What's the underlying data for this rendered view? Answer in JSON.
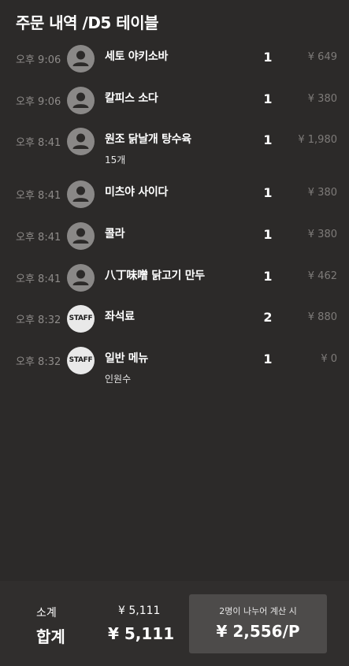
{
  "header": {
    "title": "주문 내역 /D5 테이블"
  },
  "orders": [
    {
      "time": "오후 9:06",
      "avatar": "person-icon",
      "name": "세토 야키소바",
      "note": "",
      "qty": "1",
      "price": "¥ 649"
    },
    {
      "time": "오후 9:06",
      "avatar": "person-icon",
      "name": "칼피스 소다",
      "note": "",
      "qty": "1",
      "price": "¥ 380"
    },
    {
      "time": "오후 8:41",
      "avatar": "person-icon",
      "name": "원조 닭날개 탕수육",
      "note": "15개",
      "qty": "1",
      "price": "¥ 1,980"
    },
    {
      "time": "오후 8:41",
      "avatar": "person-icon",
      "name": "미츠야 사이다",
      "note": "",
      "qty": "1",
      "price": "¥ 380"
    },
    {
      "time": "오후 8:41",
      "avatar": "person-icon",
      "name": "콜라",
      "note": "",
      "qty": "1",
      "price": "¥ 380"
    },
    {
      "time": "오후 8:41",
      "avatar": "person-icon",
      "name": "八丁味噌 닭고기 만두",
      "note": "",
      "qty": "1",
      "price": "¥ 462"
    },
    {
      "time": "오후 8:32",
      "avatar": "staff-badge",
      "avatar_text": "STAFF",
      "name": "좌석료",
      "note": "",
      "qty": "2",
      "price": "¥ 880"
    },
    {
      "time": "오후 8:32",
      "avatar": "staff-badge",
      "avatar_text": "STAFF",
      "name": "일반 메뉴",
      "note": "인원수",
      "qty": "1",
      "price": "¥ 0"
    }
  ],
  "summary": {
    "subtotal_label": "소계",
    "subtotal_value": "¥ 5,111",
    "total_label": "합계",
    "total_value": "¥ 5,111",
    "split_label": "2명이 나누어 계산 시",
    "split_value": "¥ 2,556/P"
  },
  "colors": {
    "background": "#2c2a29",
    "avatar_gray": "#8a8887",
    "staff_badge": "#e9e9e9",
    "muted_text": "#8e8b89",
    "split_button": "#4d4b4a"
  }
}
